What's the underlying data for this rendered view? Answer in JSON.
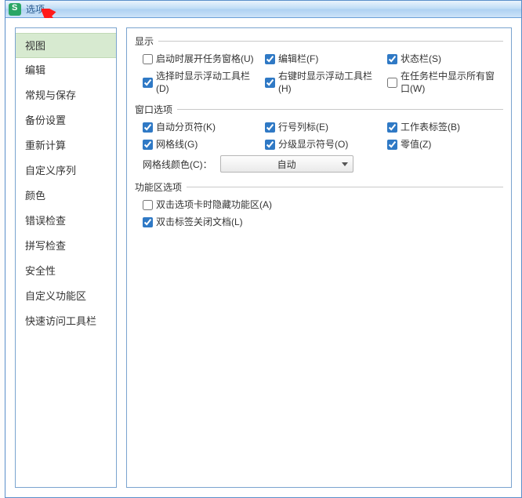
{
  "window": {
    "title": "选项"
  },
  "sidebar": {
    "items": [
      {
        "label": "视图",
        "active": true
      },
      {
        "label": "编辑"
      },
      {
        "label": "常规与保存"
      },
      {
        "label": "备份设置"
      },
      {
        "label": "重新计算"
      },
      {
        "label": "自定义序列"
      },
      {
        "label": "颜色"
      },
      {
        "label": "错误检查"
      },
      {
        "label": "拼写检查"
      },
      {
        "label": "安全性"
      },
      {
        "label": "自定义功能区"
      },
      {
        "label": "快速访问工具栏"
      }
    ]
  },
  "sections": {
    "display": {
      "legend": "显示",
      "rows": [
        [
          {
            "label": "启动时展开任务窗格(U)",
            "checked": false
          },
          {
            "label": "编辑栏(F)",
            "checked": true
          },
          {
            "label": "状态栏(S)",
            "checked": true
          }
        ],
        [
          {
            "label": "选择时显示浮动工具栏(D)",
            "checked": true
          },
          {
            "label": "右键时显示浮动工具栏(H)",
            "checked": true
          },
          {
            "label": "在任务栏中显示所有窗口(W)",
            "checked": false
          }
        ]
      ]
    },
    "windowOptions": {
      "legend": "窗口选项",
      "rows": [
        [
          {
            "label": "自动分页符(K)",
            "checked": true
          },
          {
            "label": "行号列标(E)",
            "checked": true
          },
          {
            "label": "工作表标签(B)",
            "checked": true
          }
        ],
        [
          {
            "label": "网格线(G)",
            "checked": true
          },
          {
            "label": "分级显示符号(O)",
            "checked": true
          },
          {
            "label": "零值(Z)",
            "checked": true
          }
        ]
      ],
      "gridColorLabel": "网格线颜色(C)：",
      "gridColorValue": "自动"
    },
    "ribbonOptions": {
      "legend": "功能区选项",
      "items": [
        {
          "label": "双击选项卡时隐藏功能区(A)",
          "checked": false
        },
        {
          "label": "双击标签关闭文档(L)",
          "checked": true
        }
      ]
    }
  }
}
